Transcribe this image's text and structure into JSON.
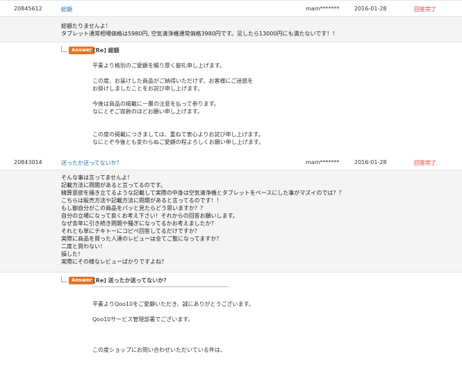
{
  "rows": [
    {
      "id": "20845612",
      "title": "総額",
      "user": "mam*******",
      "date": "2016-01-28",
      "status": "回答完了",
      "question": "総額たりませんよ！\nタブレット通常相場価格は5980円, 空気清浄機通常価格3980円です。足したら13000円にも満たないです！！",
      "answer_badge": "Answer",
      "answer_title": "[Re] 総額",
      "answer_body": "平素より格別のご愛顧を賜り厚く御礼申し上げます。\n\nこの度、お届けした商品がご納得いただけず、お客様にご迷惑を\nお掛けしましたことをお詫び申し上げます。\n\n今後は商品の掲載に一層の注意を払って参ります。\nなにとぞご容赦のほどお願い申し上げます。\n\n\nこの度の掲載につきましては、重ねて衷心よりお詫び申し上げます。\nなにとぞ今後とも変わらぬご愛顧の程よろしくお願い申し上げます。"
    },
    {
      "id": "20843014",
      "title": "送ったか送ってないか？",
      "user": "mam*******",
      "date": "2016-01-28",
      "status": "回答完了",
      "question": "そんな事は言ってませんよ！\n記載方法に問題があると言ってるのです。\n精算意欲を掻き立てるような記載して実際の中身は空気清浄機とタブレットをベースにした事がマズイのでは？？\nこちらは販売方法や記載方法に問題があると言ってるのです！！\nもし御自分がこの商品をパッと見たらどう思いますか？？\n自分の立場になって良くお考え下さい！それからの回答お願いします。\nなぜ去年に引き続き問題や騒ぎになってるかお考えましたか？\nそれとも単にテキトーにコピペ回答してるだけですか？\n実際に商品を買った人達のレビューは全てご覧になってますか？\n二度と買わない！\n損した！\n実際にその様なレビューばかりですよね？",
      "answer_badge": "Answer",
      "answer_title": "[Re] 送ったか送ってないか？",
      "answer_body": "平素よりQoo10をご愛顧いただき、誠にありがとうございます。\n\nQoo10サービス管理部署でございます。\n\n\n\nこの度ショップにお問い合わせいただいている件は、"
    }
  ]
}
